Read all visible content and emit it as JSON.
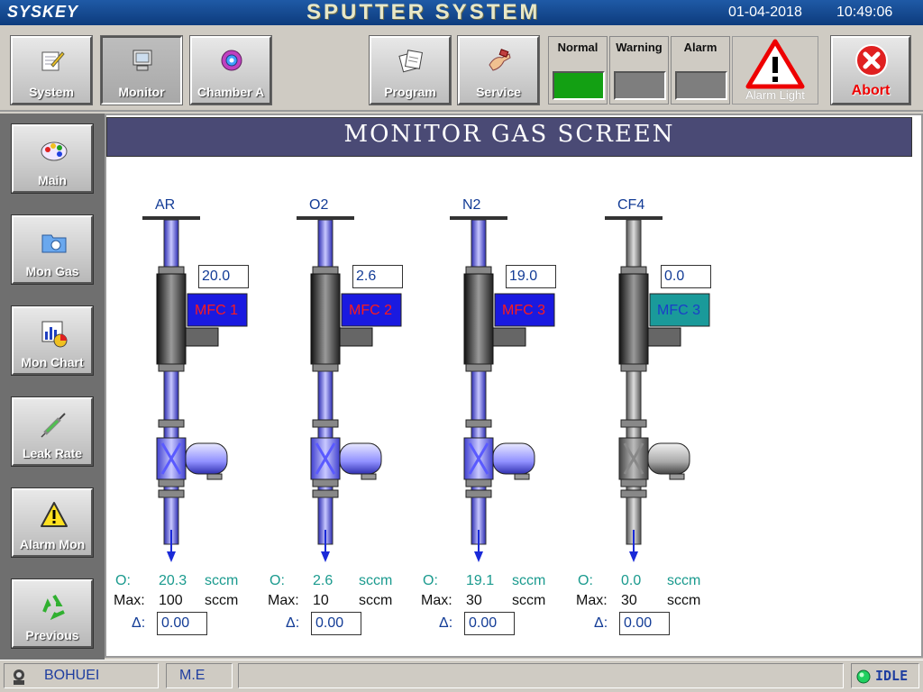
{
  "app": {
    "brand": "SYSKEY",
    "title": "SPUTTER SYSTEM",
    "date": "01-04-2018",
    "time": "10:49:06"
  },
  "toolbar": {
    "system_label": "System",
    "monitor_label": "Monitor",
    "chamber_label": "Chamber A",
    "program_label": "Program",
    "service_label": "Service",
    "normal_label": "Normal",
    "warning_label": "Warning",
    "alarm_label": "Alarm",
    "alarm_light_label": "Alarm Light",
    "abort_label": "Abort"
  },
  "lamp_colors": {
    "normal": "#13a013",
    "warning": "#7e7e7e",
    "alarm": "#7e7e7e"
  },
  "sidebar": {
    "items": [
      {
        "label": "Main",
        "icon": "palette-icon"
      },
      {
        "label": "Mon Gas",
        "icon": "folder-icon"
      },
      {
        "label": "Mon Chart",
        "icon": "chart-icon"
      },
      {
        "label": "Leak Rate",
        "icon": "syringe-icon"
      },
      {
        "label": "Alarm Mon",
        "icon": "warning-icon"
      },
      {
        "label": "Previous",
        "icon": "recycle-icon"
      }
    ]
  },
  "screen_title": "MONITOR GAS SCREEN",
  "gases": [
    {
      "name": "AR",
      "setpoint": "20.0",
      "mfc": "MFC 1",
      "out_value": "20.3",
      "max": "100",
      "delta": "0.00",
      "o_label": "O:",
      "max_label": "Max:",
      "delta_label": "Δ:",
      "unit": "sccm",
      "line_color": "#3a3ae8",
      "mfc_color": "#1a1ae0",
      "mfc_text_color": "#ff1a1a",
      "active": true
    },
    {
      "name": "O2",
      "setpoint": "2.6",
      "mfc": "MFC 2",
      "out_value": "2.6",
      "max": "10",
      "delta": "0.00",
      "o_label": "O:",
      "max_label": "Max:",
      "delta_label": "Δ:",
      "unit": "sccm",
      "line_color": "#3a3ae8",
      "mfc_color": "#1a1ae0",
      "mfc_text_color": "#ff1a1a",
      "active": true
    },
    {
      "name": "N2",
      "setpoint": "19.0",
      "mfc": "MFC 3",
      "out_value": "19.1",
      "max": "30",
      "delta": "0.00",
      "o_label": "O:",
      "max_label": "Max:",
      "delta_label": "Δ:",
      "unit": "sccm",
      "line_color": "#3a3ae8",
      "mfc_color": "#1a1ae0",
      "mfc_text_color": "#ff1a1a",
      "active": true
    },
    {
      "name": "CF4",
      "setpoint": "0.0",
      "mfc": "MFC 3",
      "out_value": "0.0",
      "max": "30",
      "delta": "0.00",
      "o_label": "O:",
      "max_label": "Max:",
      "delta_label": "Δ:",
      "unit": "sccm",
      "line_color": "#9a9a9a",
      "mfc_color": "#1a9a9a",
      "mfc_text_color": "#1a3ec8",
      "active": false
    }
  ],
  "status": {
    "user": "BOHUEI",
    "role": "M.E",
    "state": "IDLE"
  }
}
